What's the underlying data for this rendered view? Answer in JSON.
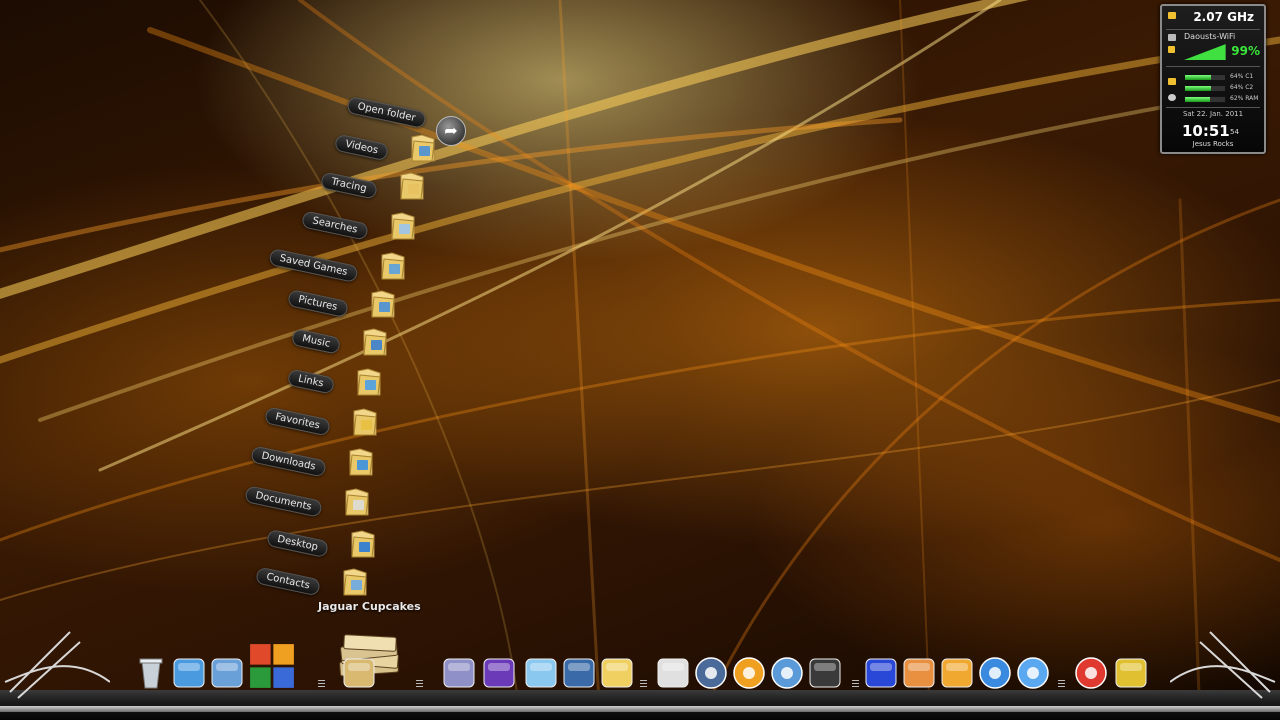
{
  "stack_menu": {
    "open_folder_label": "Open folder",
    "items": [
      {
        "label": "Videos"
      },
      {
        "label": "Tracing"
      },
      {
        "label": "Searches"
      },
      {
        "label": "Saved Games"
      },
      {
        "label": "Pictures"
      },
      {
        "label": "Music"
      },
      {
        "label": "Links"
      },
      {
        "label": "Favorites"
      },
      {
        "label": "Downloads"
      },
      {
        "label": "Documents"
      },
      {
        "label": "Desktop"
      },
      {
        "label": "Contacts"
      }
    ],
    "stack_caption": "Jaguar Cupcakes"
  },
  "system_gadget": {
    "cpu_speed": "2.07 GHz",
    "network_name": "Daousts-WiFi",
    "wifi_signal": "99%",
    "wifi_level": 0.99,
    "cores": [
      {
        "label": "64% C1",
        "level": 0.64
      },
      {
        "label": "64% C2",
        "level": 0.64
      },
      {
        "label": "62% RAM",
        "level": 0.62
      }
    ],
    "date": "Sat 22. Jan. 2011",
    "time": "10:51",
    "seconds": "54",
    "quote": "Jesus Rocks"
  },
  "dock": {
    "icons": [
      "recycle-bin-icon",
      "network-icon",
      "computer-icon",
      "avg-antivirus-icon",
      "stack-folder-icon",
      "game-controller-icon",
      "gameboy-emulator-icon",
      "notepad-icon",
      "python-icon",
      "python-script-icon",
      "paint-icon",
      "media-player-icon",
      "picasa-icon",
      "itunes-cd-icon",
      "camera-icon",
      "remote-desktop-icon",
      "video-icon",
      "headphones-icon",
      "globe-icon",
      "itunes-icon",
      "chrome-icon",
      "scissors-icon"
    ]
  }
}
